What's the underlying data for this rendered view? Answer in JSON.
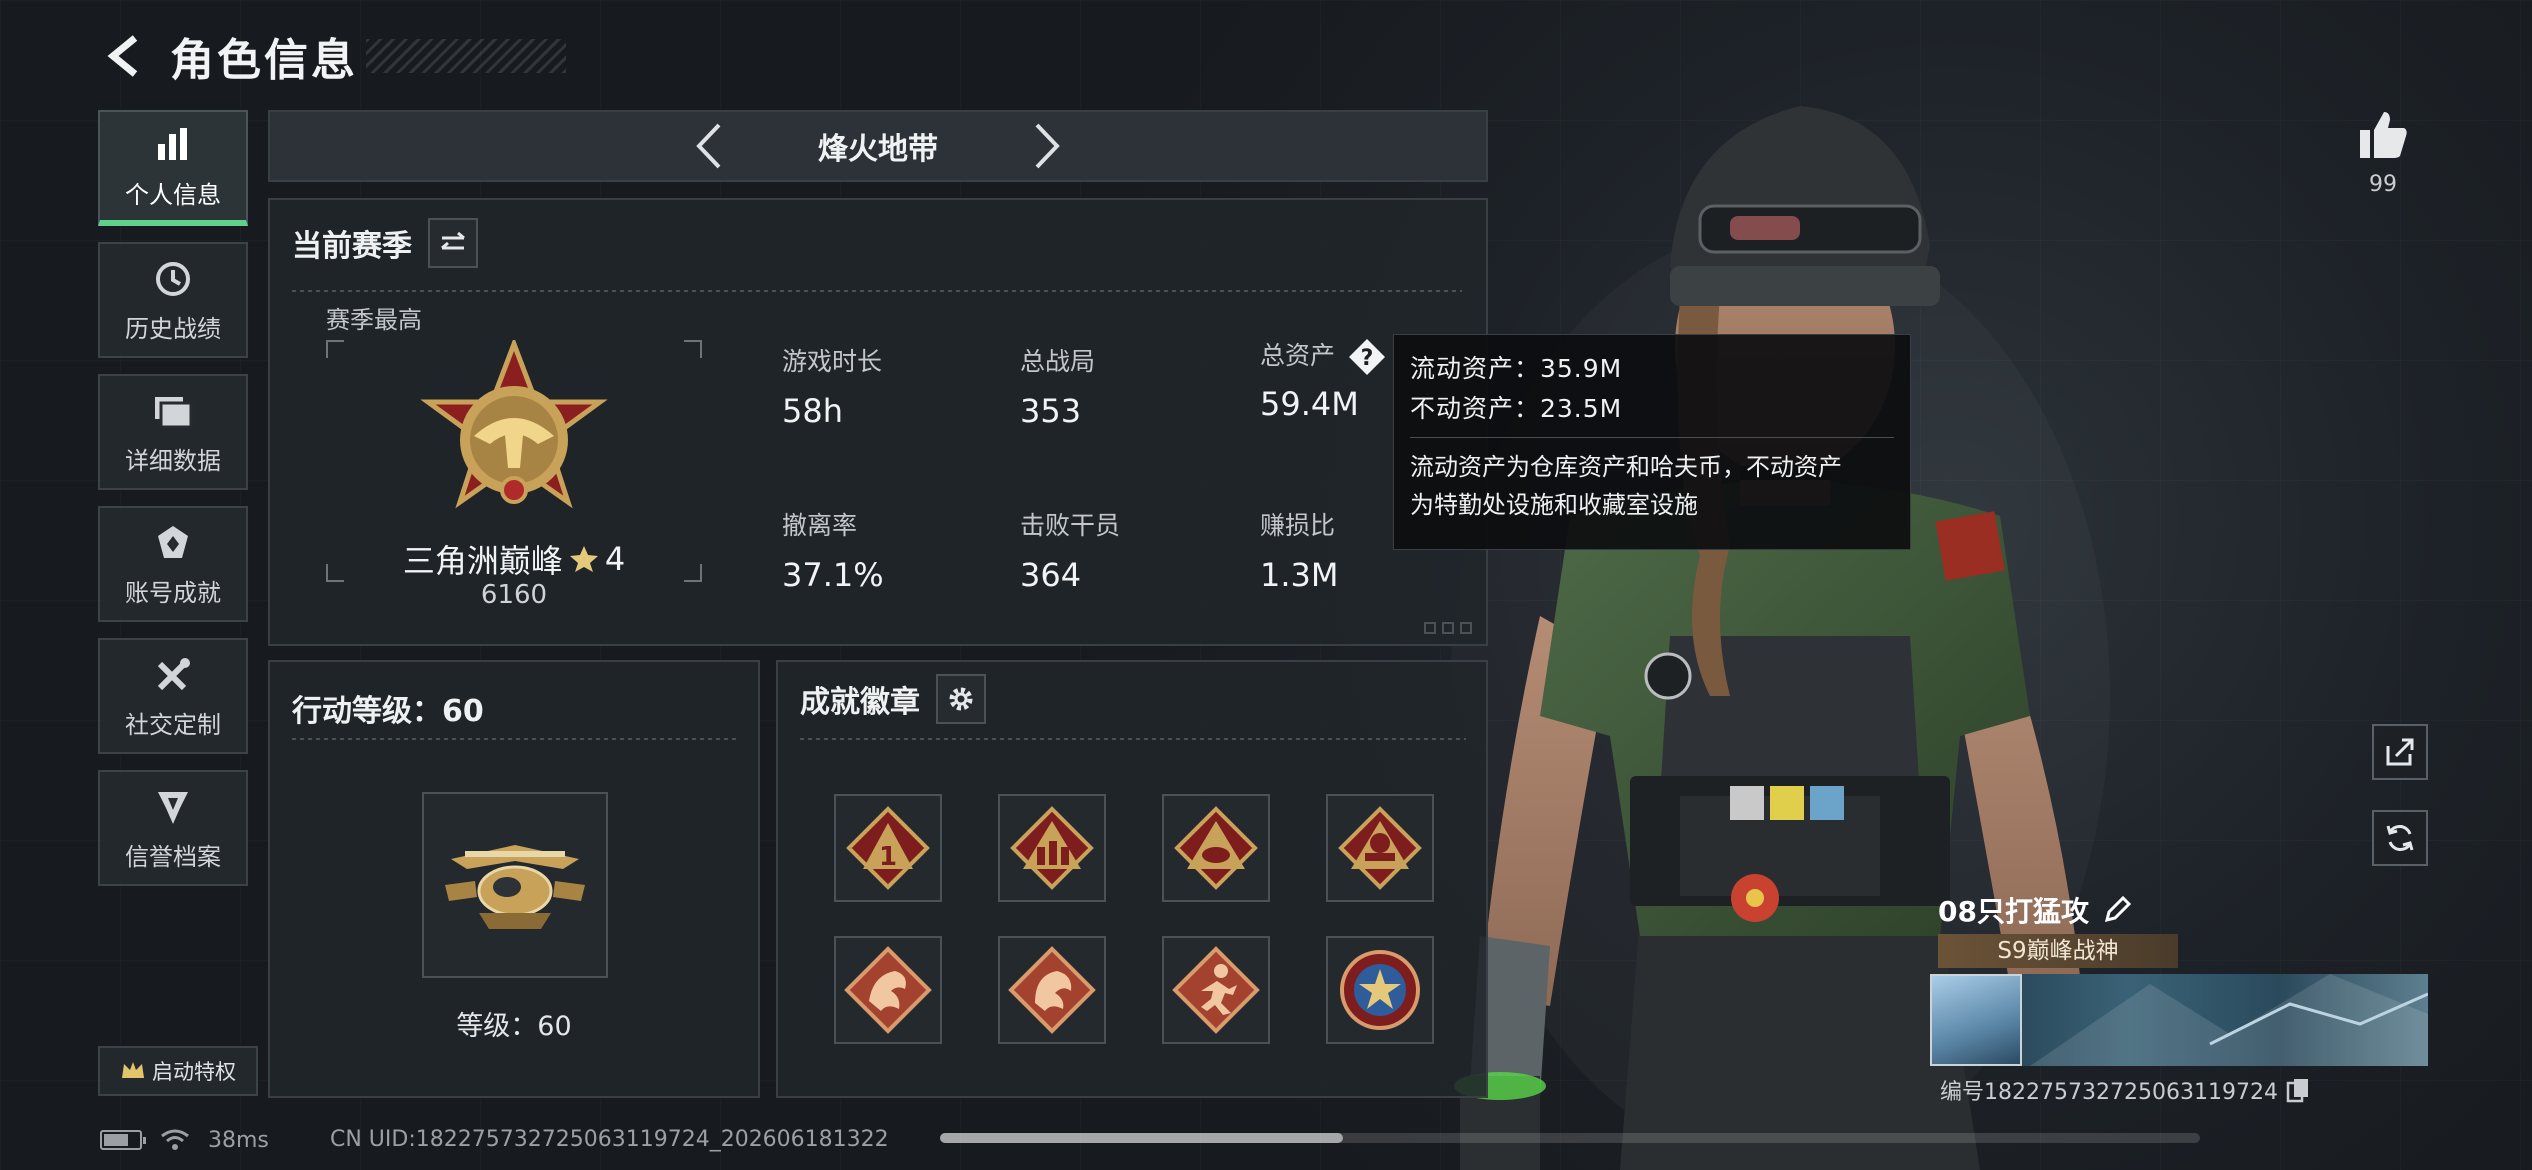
{
  "header": {
    "title": "角色信息"
  },
  "sidebar": {
    "items": [
      {
        "label": "个人信息",
        "icon": "bar-chart-icon",
        "active": true
      },
      {
        "label": "历史战绩",
        "icon": "clock-icon",
        "active": false
      },
      {
        "label": "详细数据",
        "icon": "folder-icon",
        "active": false
      },
      {
        "label": "账号成就",
        "icon": "achievement-icon",
        "active": false
      },
      {
        "label": "社交定制",
        "icon": "tools-icon",
        "active": false
      },
      {
        "label": "信誉档案",
        "icon": "credit-shield-icon",
        "active": false
      }
    ],
    "privilege_label": "启动特权"
  },
  "mode": {
    "title": "烽火地带"
  },
  "season": {
    "title": "当前赛季",
    "best_label": "赛季最高",
    "rank_name": "三角洲巅峰",
    "rank_stars": "4",
    "rank_score": "6160",
    "stats": [
      {
        "label": "游戏时长",
        "value": "58h"
      },
      {
        "label": "总战局",
        "value": "353"
      },
      {
        "label": "总资产",
        "value": "59.4M"
      },
      {
        "label": "撤离率",
        "value": "37.1%"
      },
      {
        "label": "击败干员",
        "value": "364"
      },
      {
        "label": "赚损比",
        "value": "1.3M"
      }
    ]
  },
  "tooltip": {
    "liquid": "流动资产：35.9M",
    "fixed": "不动资产：23.5M",
    "desc_line1": "流动资产为仓库资产和哈夫币，不动资产",
    "desc_line2": "为特勤处设施和收藏室设施"
  },
  "level": {
    "title": "行动等级：60",
    "text": "等级：60"
  },
  "badges": {
    "title": "成就徽章"
  },
  "status": {
    "latency": "38ms",
    "uid": "CN UID:1822757327250631197​24_202606181322"
  },
  "likes": {
    "count": "99"
  },
  "player": {
    "name": "08只打猛攻",
    "title": "S9巅峰战神",
    "id": "编号1822757327250631197​24"
  },
  "scroll": {
    "position": 0.32
  },
  "colors": {
    "accent": "#5fd18a",
    "gold": "#c9a25a",
    "badge_red": "#8b1f1f"
  }
}
